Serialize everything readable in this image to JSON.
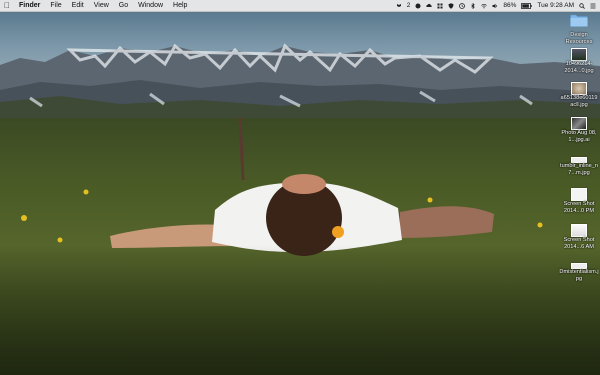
{
  "menubar": {
    "app_name": "Finder",
    "menus": [
      "File",
      "Edit",
      "View",
      "Go",
      "Window",
      "Help"
    ],
    "status": {
      "notification_count": "2",
      "battery": "86%",
      "clock": "Tue 9:28 AM"
    }
  },
  "desktop_items": [
    {
      "label": "Design Resources",
      "kind": "folder"
    },
    {
      "label": "10496214-2014...0.jpg",
      "kind": "image"
    },
    {
      "label": "a65138e60119acll.jpg",
      "kind": "image"
    },
    {
      "label": "Photo Aug 08, 1...jpg.ai",
      "kind": "image"
    },
    {
      "label": "tumblr_inline_n7...m.jpg",
      "kind": "image"
    },
    {
      "label": "Screen Shot 2014...0 PM",
      "kind": "screenshot"
    },
    {
      "label": "Screen Shot 2014...6 AM",
      "kind": "screenshot"
    },
    {
      "label": "Dmistentialism.jpg",
      "kind": "image"
    }
  ],
  "colors": {
    "menubar_bg": "#ececec",
    "folder_blue": "#7fb6e6"
  }
}
